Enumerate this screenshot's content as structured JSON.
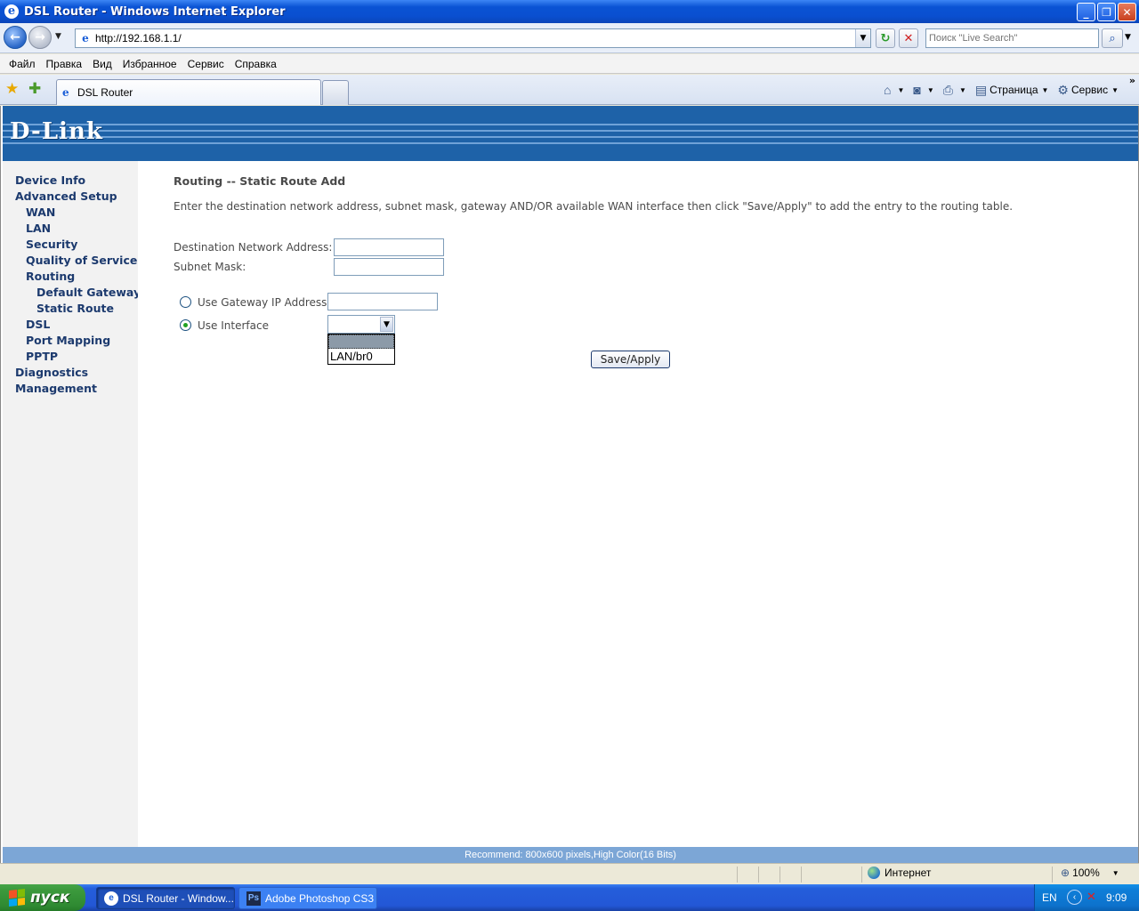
{
  "window": {
    "title": "DSL Router - Windows Internet Explorer",
    "minimize": "_",
    "maximize": "❐",
    "close": "✕"
  },
  "browser": {
    "url": "http://192.168.1.1/",
    "search_placeholder": "Поиск \"Live Search\"",
    "menu": [
      "Файл",
      "Правка",
      "Вид",
      "Избранное",
      "Сервис",
      "Справка"
    ],
    "tab_label": "DSL Router",
    "tools": {
      "page": "Страница",
      "service": "Сервис"
    }
  },
  "page": {
    "logo": "D-Link",
    "nav": [
      "Device Info",
      "Advanced Setup",
      "WAN",
      "LAN",
      "Security",
      "Quality of Service",
      "Routing",
      "Default Gateway",
      "Static Route",
      "DSL",
      "Port Mapping",
      "PPTP",
      "Diagnostics",
      "Management"
    ],
    "heading": "Routing -- Static Route Add",
    "description": "Enter the destination network address, subnet mask, gateway AND/OR available WAN interface then click \"Save/Apply\" to add the entry to the routing table.",
    "form": {
      "dest_label": "Destination Network Address:",
      "dest_value": "",
      "mask_label": "Subnet Mask:",
      "mask_value": "",
      "gateway_label": "Use Gateway IP Address",
      "gateway_value": "",
      "interface_label": "Use Interface",
      "interface_selected": "",
      "interface_options": [
        "",
        "LAN/br0"
      ],
      "save_label": "Save/Apply"
    },
    "footer": "Recommend: 800x600 pixels,High Color(16 Bits)"
  },
  "statusbar": {
    "zone": "Интернет",
    "zoom": "100%"
  },
  "taskbar": {
    "start": "пуск",
    "tasks": [
      "DSL Router - Window...",
      "Adobe Photoshop CS3"
    ],
    "lang": "EN",
    "clock": "9:09"
  }
}
